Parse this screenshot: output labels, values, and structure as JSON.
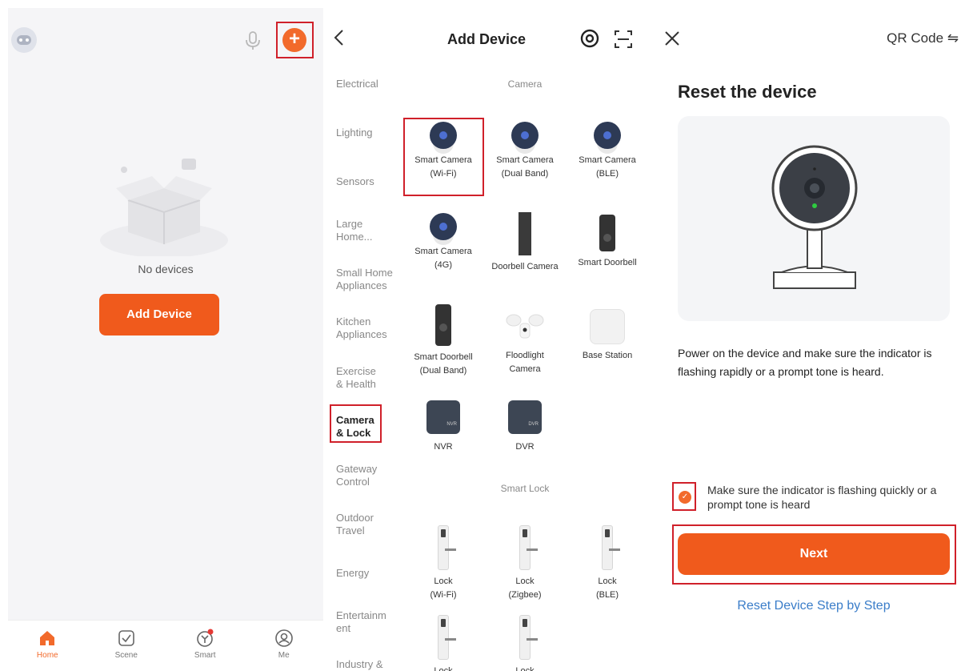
{
  "home": {
    "empty_text": "No devices",
    "add_button": "Add Device",
    "tabs": [
      {
        "label": "Home",
        "icon": "home-icon"
      },
      {
        "label": "Scene",
        "icon": "scene-icon"
      },
      {
        "label": "Smart",
        "icon": "smart-icon"
      },
      {
        "label": "Me",
        "icon": "me-icon"
      }
    ]
  },
  "add_device": {
    "title": "Add Device",
    "categories": [
      "Electrical",
      "Lighting",
      "Sensors",
      "Large Home...",
      "Small Home Appliances",
      "Kitchen Appliances",
      "Exercise & Health",
      "Camera & Lock",
      "Gateway Control",
      "Outdoor Travel",
      "Energy",
      "Entertainm ent",
      "Industry &"
    ],
    "selected_category": "Camera & Lock",
    "section_camera": "Camera",
    "section_lock": "Smart Lock",
    "devices": [
      {
        "name": "Smart Camera",
        "sub": "(Wi-Fi)"
      },
      {
        "name": "Smart Camera",
        "sub": "(Dual Band)"
      },
      {
        "name": "Smart Camera",
        "sub": "(BLE)"
      },
      {
        "name": "Smart Camera",
        "sub": "(4G)"
      },
      {
        "name": "Doorbell Camera",
        "sub": ""
      },
      {
        "name": "Smart Doorbell",
        "sub": ""
      },
      {
        "name": "Smart Doorbell",
        "sub": "(Dual Band)"
      },
      {
        "name": "Floodlight",
        "sub": "Camera"
      },
      {
        "name": "Base Station",
        "sub": ""
      },
      {
        "name": "NVR",
        "sub": ""
      },
      {
        "name": "DVR",
        "sub": ""
      }
    ],
    "locks": [
      {
        "name": "Lock",
        "sub": "(Wi-Fi)"
      },
      {
        "name": "Lock",
        "sub": "(Zigbee)"
      },
      {
        "name": "Lock",
        "sub": "(BLE)"
      },
      {
        "name": "Lock",
        "sub": ""
      },
      {
        "name": "Lock",
        "sub": ""
      }
    ]
  },
  "reset": {
    "qr_link": "QR Code ⇋",
    "title": "Reset the device",
    "instruction": "Power on the device and make sure the indicator is flashing rapidly or a prompt tone is heard.",
    "confirm_text": "Make sure the indicator is flashing quickly or a prompt tone is heard",
    "next_button": "Next",
    "step_link": "Reset Device Step by Step"
  },
  "colors": {
    "accent": "#f05a1c",
    "highlight_box": "#d0202a",
    "link": "#3a7dc9"
  }
}
